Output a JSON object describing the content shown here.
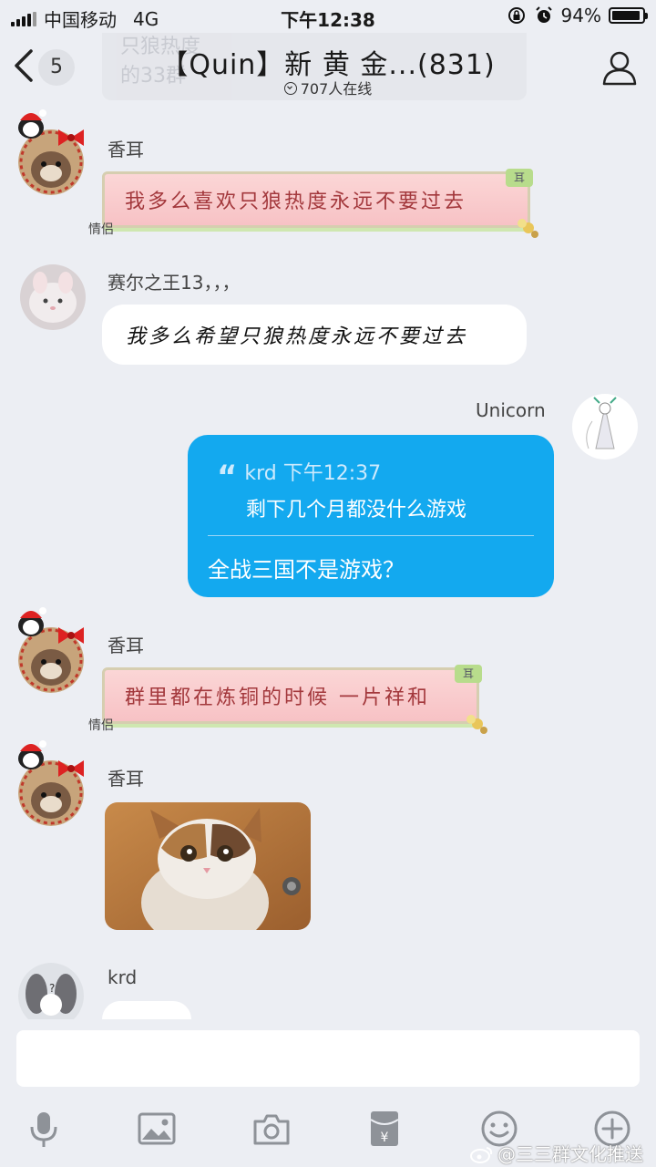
{
  "status_bar": {
    "carrier": "中国移动",
    "network": "4G",
    "time": "下午12:38",
    "battery": "94%",
    "battery_level": 0.94
  },
  "header": {
    "back_count": "5",
    "title": "【Quin】新 黄 金...(831)",
    "online": "707人在线",
    "ghost_line1": "只狼热度",
    "ghost_line2": "的33群"
  },
  "messages": [
    {
      "sender": "香耳",
      "text": "我多么喜欢只狼热度永远不要过去",
      "badge": "耳",
      "tag": "情侣"
    },
    {
      "sender": "赛尔之王13，，，",
      "text": "我多么希望只狼热度永远不要过去"
    },
    {
      "sender": "Unicorn",
      "quote_author": "krd",
      "quote_time": "下午12:37",
      "quote_mark": "“",
      "quote_text": "剩下几个月都没什么游戏",
      "reply": "全战三国不是游戏？"
    },
    {
      "sender": "香耳",
      "text": "群里都在炼铜的时候 一片祥和",
      "badge": "耳",
      "tag": "情侣"
    },
    {
      "sender": "香耳",
      "image": "cat-photo"
    },
    {
      "sender": "krd"
    }
  ],
  "input": {
    "placeholder": ""
  },
  "toolbar": {
    "icons": [
      "microphone-icon",
      "image-icon",
      "camera-icon",
      "red-packet-icon",
      "emoji-icon",
      "plus-icon"
    ],
    "red_packet_symbol": "¥"
  },
  "watermark": "@三三群文化推送",
  "colors": {
    "background": "#eceef3",
    "self_bubble": "#13a9ef",
    "scroll_text": "#a3383c"
  }
}
